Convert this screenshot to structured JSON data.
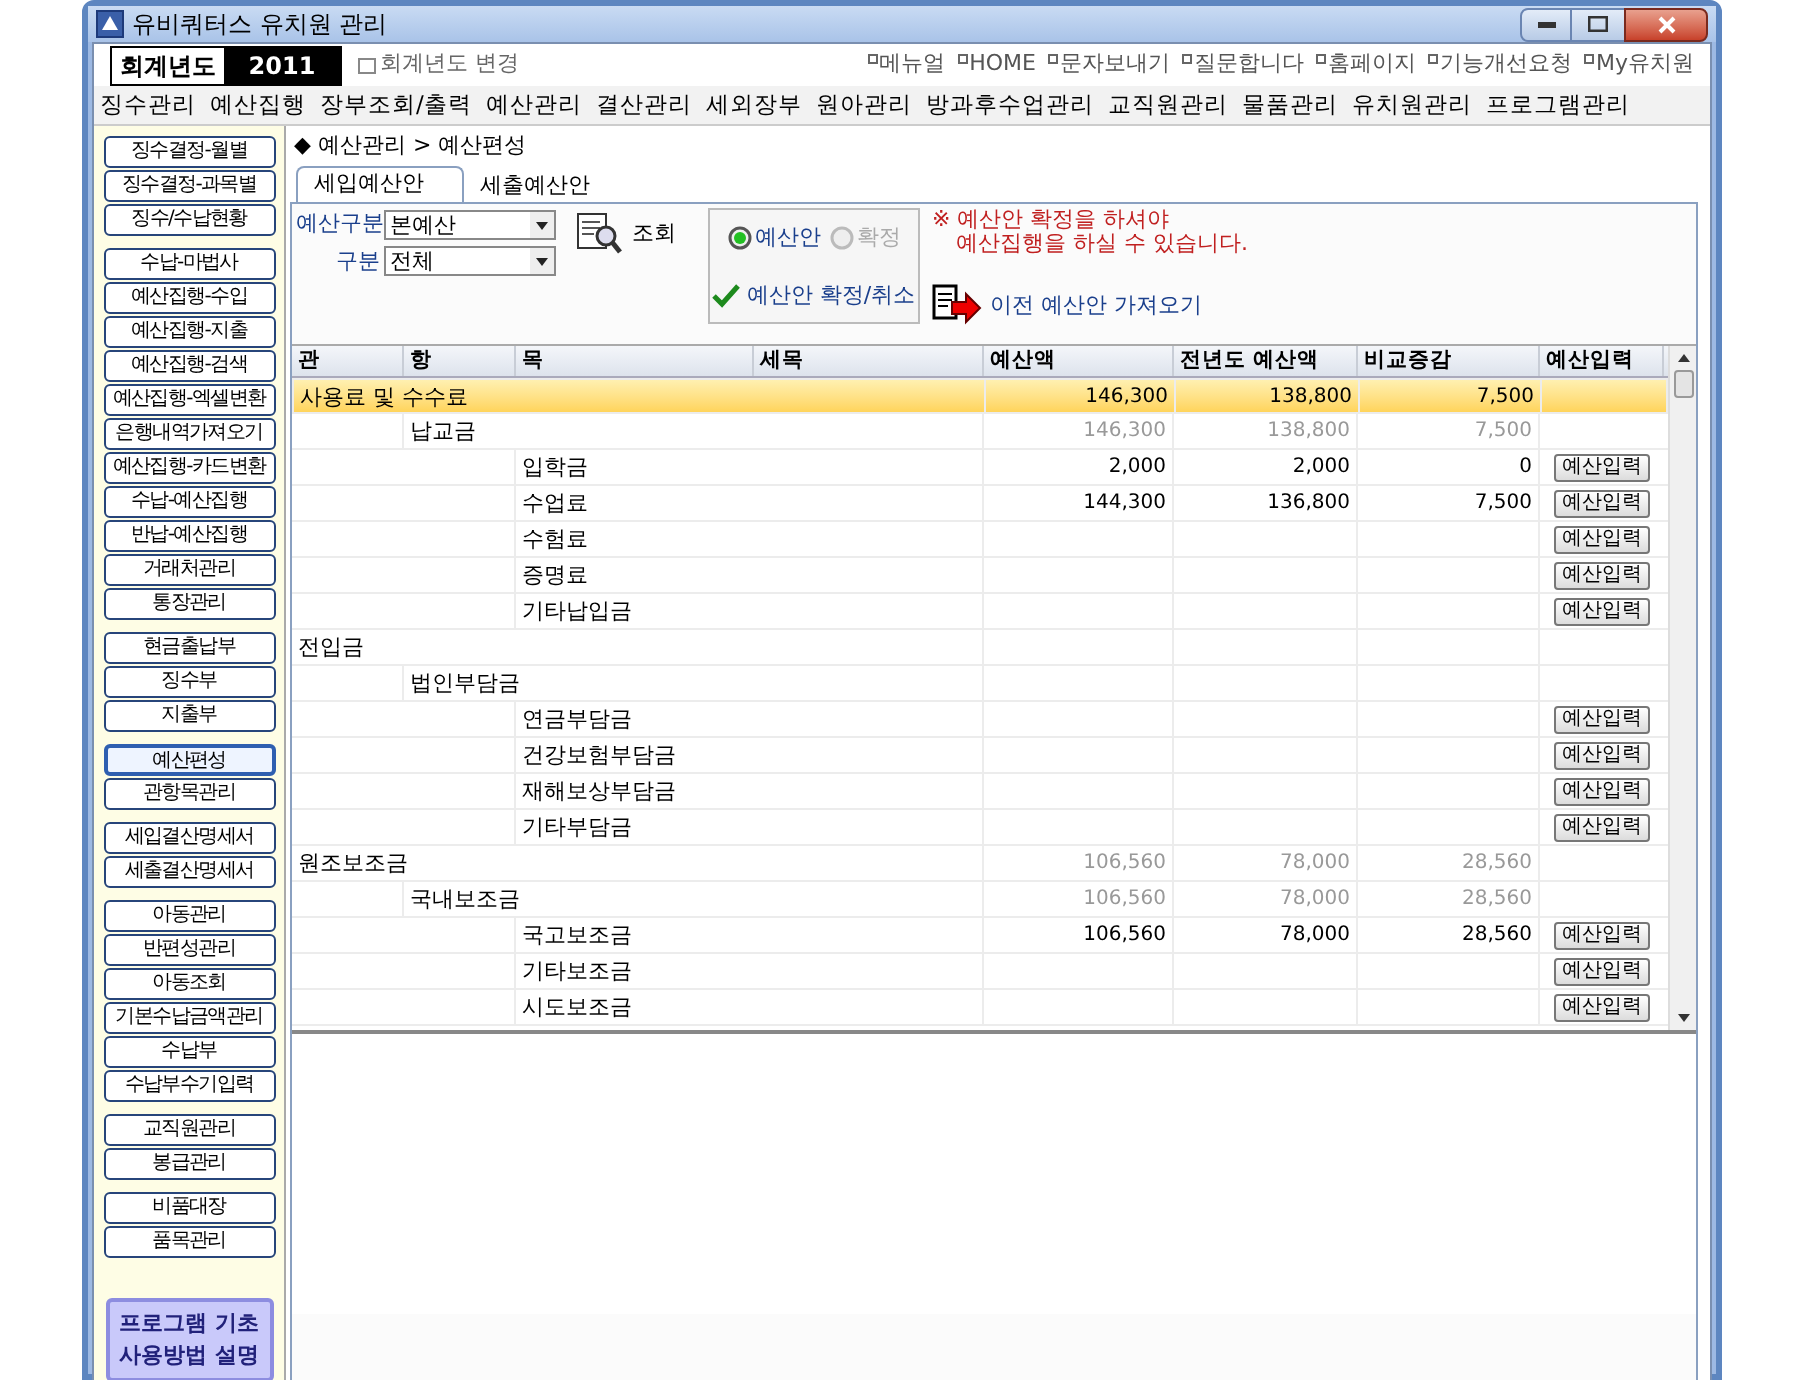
{
  "window": {
    "title": "유비쿼터스 유치원 관리"
  },
  "fiscal_year": {
    "label": "회계년도",
    "value": "2011",
    "change_link": "회계년도 변경"
  },
  "top_links": [
    "메뉴얼",
    "HOME",
    "문자보내기",
    "질문합니다",
    "홈페이지",
    "기능개선요청",
    "My유치원"
  ],
  "menu": [
    "징수관리",
    "예산집행",
    "장부조회/출력",
    "예산관리",
    "결산관리",
    "세외장부",
    "원아관리",
    "방과후수업관리",
    "교직원관리",
    "물품관리",
    "유치원관리",
    "프로그램관리"
  ],
  "sidebar": {
    "groups": [
      {
        "items": [
          {
            "label": "징수결정-월별",
            "selected": false
          },
          {
            "label": "징수결정-과목별",
            "selected": false
          },
          {
            "label": "징수/수납현황",
            "selected": false
          }
        ]
      },
      {
        "items": [
          {
            "label": "수납-마법사",
            "selected": false
          },
          {
            "label": "예산집행-수입",
            "selected": false
          },
          {
            "label": "예산집행-지출",
            "selected": false
          },
          {
            "label": "예산집행-검색",
            "selected": false
          },
          {
            "label": "예산집행-엑셀변환",
            "selected": false
          },
          {
            "label": "은행내역가져오기",
            "selected": false
          },
          {
            "label": "예산집행-카드변환",
            "selected": false
          },
          {
            "label": "수납-예산집행",
            "selected": false
          },
          {
            "label": "반납-예산집행",
            "selected": false
          },
          {
            "label": "거래처관리",
            "selected": false
          },
          {
            "label": "통장관리",
            "selected": false
          }
        ]
      },
      {
        "items": [
          {
            "label": "현금출납부",
            "selected": false
          },
          {
            "label": "징수부",
            "selected": false
          },
          {
            "label": "지출부",
            "selected": false
          }
        ]
      },
      {
        "items": [
          {
            "label": "예산편성",
            "selected": true
          },
          {
            "label": "관항목관리",
            "selected": false
          }
        ]
      },
      {
        "items": [
          {
            "label": "세입결산명세서",
            "selected": false
          },
          {
            "label": "세출결산명세서",
            "selected": false
          }
        ]
      },
      {
        "items": [
          {
            "label": "아동관리",
            "selected": false
          },
          {
            "label": "반편성관리",
            "selected": false
          },
          {
            "label": "아동조회",
            "selected": false
          },
          {
            "label": "기본수납금액관리",
            "selected": false
          },
          {
            "label": "수납부",
            "selected": false
          },
          {
            "label": "수납부수기입력",
            "selected": false
          }
        ]
      },
      {
        "items": [
          {
            "label": "교직원관리",
            "selected": false
          },
          {
            "label": "봉급관리",
            "selected": false
          }
        ]
      },
      {
        "items": [
          {
            "label": "비품대장",
            "selected": false
          },
          {
            "label": "품목관리",
            "selected": false
          }
        ]
      }
    ],
    "help_button": [
      "프로그램 기초",
      "사용방법 설명"
    ]
  },
  "breadcrumb": "◆ 예산관리 > 예산편성",
  "tabs": [
    {
      "label": "세입예산안",
      "selected": true
    },
    {
      "label": "세출예산안",
      "selected": false
    }
  ],
  "filters": [
    {
      "label": "예산구분",
      "value": "본예산"
    },
    {
      "label": "구분",
      "value": "전체"
    }
  ],
  "search_button": "조회",
  "status_radios": [
    {
      "label": "예산안",
      "selected": true,
      "disabled": false
    },
    {
      "label": "확정",
      "selected": false,
      "disabled": true
    }
  ],
  "confirm_button": "예산안 확정/취소",
  "notice": [
    "※ 예산안 확정을 하셔야",
    "예산집행을 하실 수 있습니다."
  ],
  "import_button": "이전 예산안 가져오기",
  "table": {
    "columns": [
      "관",
      "항",
      "목",
      "세목",
      "예산액",
      "전년도 예산액",
      "비교증감",
      "예산입력"
    ],
    "rows": [
      {
        "name": "사용료 및 수수료",
        "budget": "146,300",
        "previous": "138,800",
        "change": "7,500",
        "muted": false,
        "selected": true,
        "children": [
          {
            "name": "납교금",
            "budget": "146,300",
            "previous": "138,800",
            "change": "7,500",
            "muted": true,
            "selected": false,
            "children": [
              {
                "name": "입학금",
                "budget": "2,000",
                "previous": "2,000",
                "change": "0",
                "button": "예산입력",
                "muted": false,
                "selected": false
              },
              {
                "name": "수업료",
                "budget": "144,300",
                "previous": "136,800",
                "change": "7,500",
                "button": "예산입력",
                "muted": false,
                "selected": false
              },
              {
                "name": "수험료",
                "button": "예산입력",
                "selected": false
              },
              {
                "name": "증명료",
                "button": "예산입력",
                "selected": false
              },
              {
                "name": "기타납입금",
                "button": "예산입력",
                "selected": false
              }
            ]
          }
        ]
      },
      {
        "name": "전입금",
        "selected": false,
        "children": [
          {
            "name": "법인부담금",
            "selected": false,
            "children": [
              {
                "name": "연금부담금",
                "button": "예산입력",
                "selected": false
              },
              {
                "name": "건강보험부담금",
                "button": "예산입력",
                "selected": false
              },
              {
                "name": "재해보상부담금",
                "button": "예산입력",
                "selected": false
              },
              {
                "name": "기타부담금",
                "button": "예산입력",
                "selected": false
              }
            ]
          }
        ]
      },
      {
        "name": "원조보조금",
        "budget": "106,560",
        "previous": "78,000",
        "change": "28,560",
        "muted": true,
        "selected": false,
        "children": [
          {
            "name": "국내보조금",
            "budget": "106,560",
            "previous": "78,000",
            "change": "28,560",
            "muted": true,
            "selected": false,
            "children": [
              {
                "name": "국고보조금",
                "budget": "106,560",
                "previous": "78,000",
                "change": "28,560",
                "button": "예산입력",
                "muted": false,
                "selected": false
              },
              {
                "name": "기타보조금",
                "button": "예산입력",
                "selected": false
              },
              {
                "name": "시도보조금",
                "button": "예산입력",
                "selected": false
              }
            ]
          }
        ]
      }
    ]
  }
}
